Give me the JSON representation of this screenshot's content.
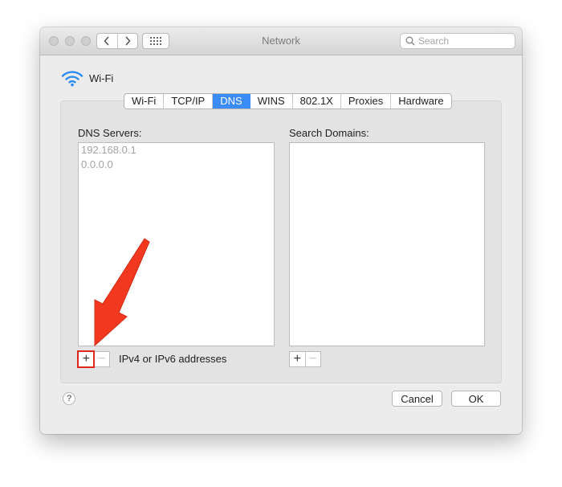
{
  "window": {
    "title": "Network",
    "search_placeholder": "Search",
    "icons": {
      "back": "chevron-left-icon",
      "forward": "chevron-right-icon",
      "show_all": "grid-icon",
      "search": "search-icon"
    }
  },
  "interface": {
    "name": "Wi-Fi",
    "icon": "wifi-icon"
  },
  "tabs": [
    {
      "label": "Wi-Fi"
    },
    {
      "label": "TCP/IP"
    },
    {
      "label": "DNS"
    },
    {
      "label": "WINS"
    },
    {
      "label": "802.1X"
    },
    {
      "label": "Proxies"
    },
    {
      "label": "Hardware"
    }
  ],
  "active_tab": "DNS",
  "dns_servers": {
    "label": "DNS Servers:",
    "entries": [
      "192.168.0.1",
      "0.0.0.0"
    ],
    "add_label": "+",
    "remove_label": "−",
    "hint": "IPv4 or IPv6 addresses"
  },
  "search_domains": {
    "label": "Search Domains:",
    "entries": [],
    "add_label": "+",
    "remove_label": "−"
  },
  "footer": {
    "help_label": "?",
    "cancel_label": "Cancel",
    "ok_label": "OK"
  },
  "annotation": {
    "color": "#e0271d",
    "target": "dns-add-button"
  },
  "colors": {
    "accent": "#3b8cf6",
    "placeholder_entry": "#a3a3a3"
  }
}
